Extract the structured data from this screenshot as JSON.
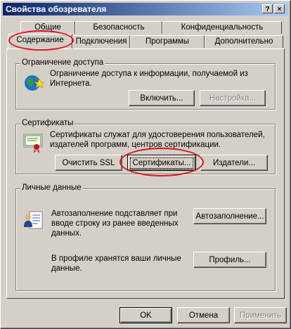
{
  "window": {
    "title": "Свойства обозревателя"
  },
  "titlebar_buttons": {
    "help": "?",
    "close": "×"
  },
  "tabs_row1": [
    "Общие",
    "Безопасность",
    "Конфиденциальность"
  ],
  "tabs_row2": [
    "Содержание",
    "Подключения",
    "Программы",
    "Дополнительно"
  ],
  "active_tab": "Содержание",
  "access": {
    "group_title": "Ограничение доступа",
    "text": "Ограничение доступа к информации, получаемой из Интернета.",
    "enable_button": "Включить...",
    "settings_button": "Настройка..."
  },
  "certificates": {
    "group_title": "Сертификаты",
    "text": "Сертификаты служат для удостоверения пользователей, издателей программ, центров сертификации.",
    "clear_ssl_button": "Очистить SSL",
    "certificates_button": "Сертификаты...",
    "publishers_button": "Издатели..."
  },
  "personal": {
    "group_title": "Личные данные",
    "autocomplete_text": "Автозаполнение подставляет при вводе строку из ранее введенных данных.",
    "autocomplete_button": "Автозаполнение...",
    "profile_text": "В профиле хранятся ваши личные данные.",
    "profile_button": "Профиль..."
  },
  "footer": {
    "ok": "OK",
    "cancel": "Отмена",
    "apply": "Применить"
  },
  "colors": {
    "highlight_ellipse": "#e0101a",
    "title_bar": "#0a246a"
  }
}
